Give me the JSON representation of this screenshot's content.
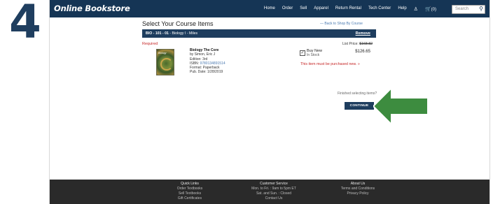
{
  "step_number": "4",
  "header": {
    "logo": "Online Bookstore",
    "nav": [
      "Home",
      "Order",
      "Sell",
      "Apparel",
      "Return Rental",
      "Tech Center",
      "Help"
    ],
    "cart_count": "(0)",
    "search_placeholder": "Search"
  },
  "page": {
    "title": "Select Your Course Items",
    "back_link": "— Back to Shop By Course"
  },
  "course": {
    "code": "BIO - 101 - 01",
    "details": "- Biology I - Miles",
    "remove": "Remove"
  },
  "item": {
    "required_label": "Required",
    "list_price_label": "List Price:",
    "list_price": "$168.82",
    "book": {
      "title": "Biology The Core",
      "author": "by Simon, Eric J",
      "edition": "Edition: 3rd",
      "isbn_label": "ISBN:",
      "isbn": "9780134891514",
      "format": "Format: Paperback",
      "pub_date": "Pub. Date: 1/28/2019",
      "cover_text": "Biology"
    },
    "option_label": "Buy New",
    "stock": "In Stock",
    "price": "$126.65",
    "must_purchase_new": "This item must be purchased new. »"
  },
  "finish": {
    "prompt": "Finished selecting items?",
    "button": "CONTINUE"
  },
  "footer": {
    "quick_links": {
      "heading": "Quick Links",
      "items": [
        "Order Textbooks",
        "Sell Textbooks",
        "Gift Certificates"
      ]
    },
    "customer_service": {
      "heading": "Customer Service",
      "items": [
        "Mon. to Fri. : 9am to 5pm ET",
        "Sat. and Sun. : Closed",
        "Contact Us"
      ]
    },
    "about": {
      "heading": "About Us",
      "items": [
        "Terms and Conditions",
        "Privacy Policy"
      ]
    }
  },
  "colors": {
    "header_bg": "#153555",
    "course_bar": "#1e3d5e",
    "accent_red": "#c62828",
    "arrow_green": "#3d8c3f",
    "footer_bg": "#2a2a2a",
    "step_number": "#1f3e5f"
  }
}
